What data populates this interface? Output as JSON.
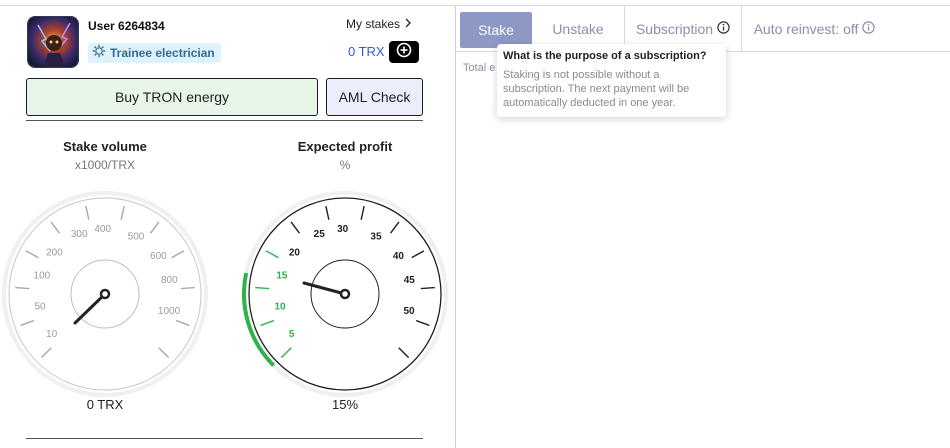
{
  "user": {
    "name": "User 6264834",
    "role": "Trainee electrician",
    "balance": "0 TRX",
    "my_stakes_label": "My stakes"
  },
  "actions": {
    "buy_label": "Buy TRON energy",
    "aml_label": "AML Check"
  },
  "stake_gauge": {
    "title": "Stake volume",
    "unit": "x1000/TRX",
    "value_text": "0 TRX",
    "ticks": [
      "10",
      "50",
      "100",
      "200",
      "300",
      "400",
      "500",
      "600",
      "800",
      "1000"
    ]
  },
  "profit_gauge": {
    "title": "Expected profit",
    "unit": "%",
    "value_text": "15%",
    "ticks": [
      "5",
      "10",
      "15",
      "20",
      "25",
      "30",
      "35",
      "40",
      "45",
      "50"
    ],
    "highlighted_ticks": [
      "5",
      "10",
      "15"
    ],
    "accent_color": "#2db34a"
  },
  "tabs": {
    "stake": "Stake",
    "unstake": "Unstake",
    "subscription": "Subscription",
    "auto_reinvest": "Auto reinvest: off"
  },
  "main": {
    "total_label": "Total e"
  },
  "tooltip": {
    "title": "What is the purpose of a subscription?",
    "body": "Staking is not possible without a subscription. The next payment will be automatically deducted in one year."
  },
  "colors": {
    "active_tab": "#8e98c4",
    "balance_blue": "#2a5fd6",
    "buy_bg": "#e8f6e9",
    "aml_bg": "#eceefc",
    "badge_bg": "#dff2fb"
  }
}
